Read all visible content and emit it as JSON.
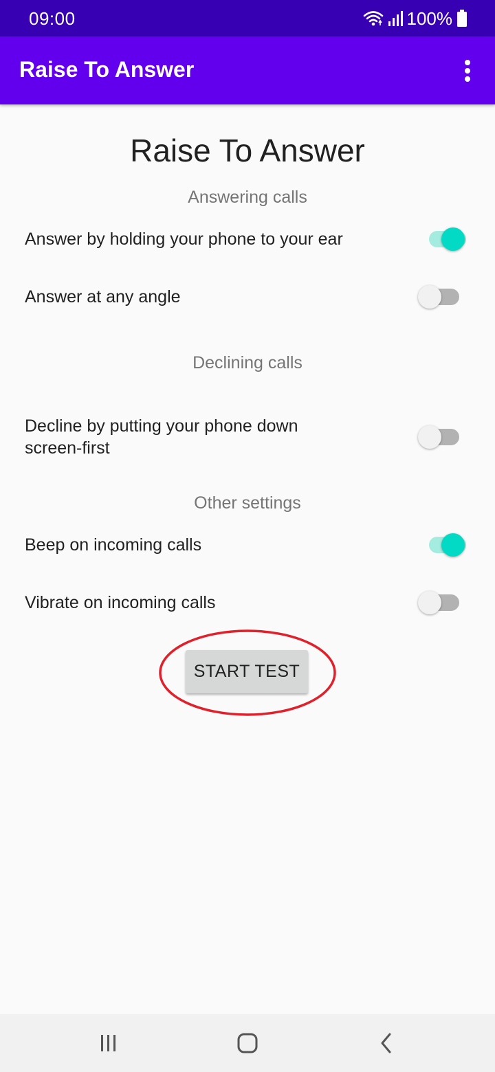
{
  "status_bar": {
    "time": "09:00",
    "battery": "100%",
    "icons": [
      "wifi-icon",
      "signal-icon",
      "battery-icon"
    ]
  },
  "app_bar": {
    "title": "Raise To Answer",
    "menu_icon": "overflow-menu-icon"
  },
  "main": {
    "title": "Raise To Answer",
    "sections": [
      {
        "header": "Answering calls",
        "settings": [
          {
            "label": "Answer by holding your phone to your ear",
            "enabled": true
          },
          {
            "label": "Answer at any angle",
            "enabled": false
          }
        ]
      },
      {
        "header": "Declining calls",
        "settings": [
          {
            "label": "Decline by putting your phone down screen-first",
            "enabled": false
          }
        ]
      },
      {
        "header": "Other settings",
        "settings": [
          {
            "label": "Beep on incoming calls",
            "enabled": true
          },
          {
            "label": "Vibrate on incoming calls",
            "enabled": false
          }
        ]
      }
    ],
    "start_test_label": "START TEST"
  },
  "colors": {
    "status_bar": "#3700b3",
    "app_bar": "#6200ee",
    "switch_on": "#03dac5",
    "annotation": "#e0202a"
  },
  "nav_bar": {
    "icons": [
      "recent-apps-icon",
      "home-icon",
      "back-icon"
    ]
  }
}
